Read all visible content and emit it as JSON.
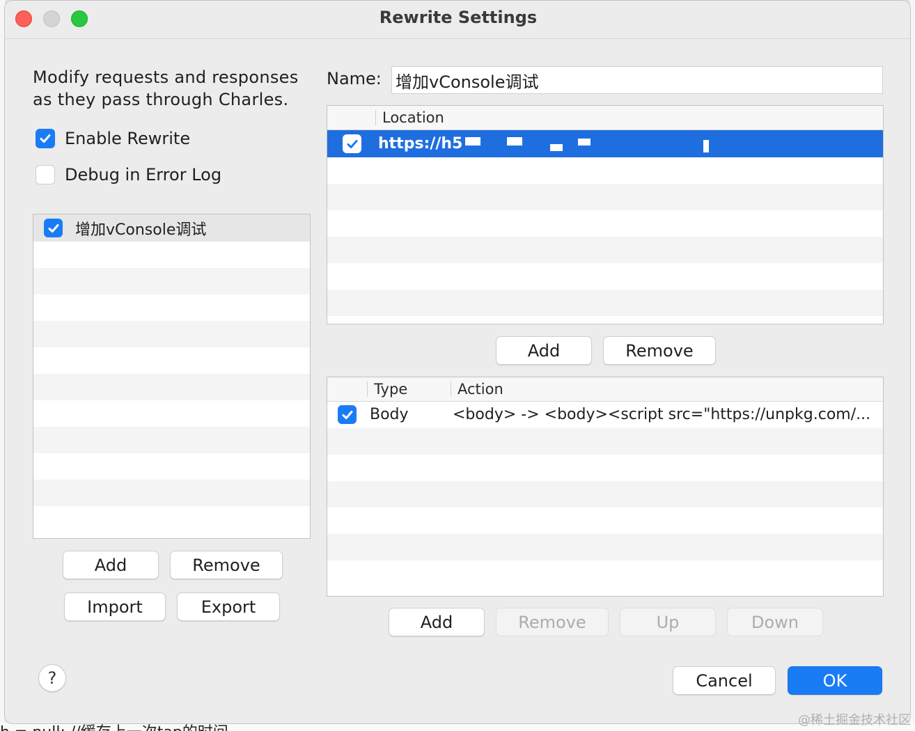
{
  "window": {
    "title": "Rewrite Settings"
  },
  "description": "Modify requests and responses as they pass through Charles.",
  "options": {
    "enable_rewrite": {
      "label": "Enable Rewrite",
      "checked": true
    },
    "debug_error_log": {
      "label": "Debug in Error Log",
      "checked": false
    }
  },
  "sets": {
    "items": [
      {
        "label": "增加vConsole调试",
        "checked": true
      }
    ],
    "buttons": {
      "add": "Add",
      "remove": "Remove",
      "import": "Import",
      "export": "Export"
    }
  },
  "name_field": {
    "label": "Name:",
    "value": "增加vConsole调试"
  },
  "locations": {
    "column": "Location",
    "rows": [
      {
        "checked": true,
        "value": "https://h5"
      }
    ],
    "buttons": {
      "add": "Add",
      "remove": "Remove"
    }
  },
  "rules": {
    "columns": {
      "type": "Type",
      "action": "Action"
    },
    "rows": [
      {
        "checked": true,
        "type": "Body",
        "action": "<body> -> <body><script src=\"https://unpkg.com/..."
      }
    ],
    "buttons": {
      "add": "Add",
      "remove": "Remove",
      "up": "Up",
      "down": "Down"
    }
  },
  "help": "?",
  "dialog_buttons": {
    "cancel": "Cancel",
    "ok": "OK"
  },
  "watermark": "@稀土掘金技术社区",
  "background_text": "h = null; //缓存上一次tap的时间",
  "colors": {
    "accent": "#1a7cf5",
    "close": "#fe5f57",
    "maximize": "#28c840"
  }
}
